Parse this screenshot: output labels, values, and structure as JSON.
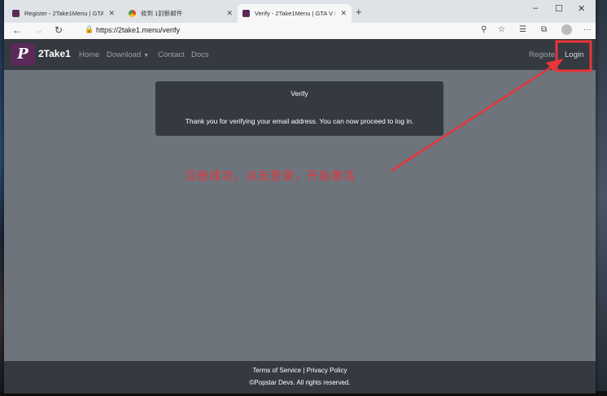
{
  "browser": {
    "tabs": [
      {
        "title": "Register - 2Take1Menu | GTA V M"
      },
      {
        "title": "收到 1封新邮件"
      },
      {
        "title": "Verify - 2Take1Menu | GTA V Mo"
      }
    ],
    "url": "https://2take1.menu/verify",
    "controls": {
      "minimize": "–",
      "maximize": "☐",
      "close": "✕"
    }
  },
  "site": {
    "logo_letter": "P",
    "brand": "2Take1",
    "nav": {
      "home": "Home",
      "download": "Download",
      "contact": "Contact",
      "docs": "Docs",
      "register": "Registe",
      "login": "Login"
    }
  },
  "verify_card": {
    "heading": "Verify",
    "message": "Thank you for verifying your email address. You can now proceed to log in."
  },
  "annotation": {
    "text": "注册成功，点击登录，开始激活",
    "color": "#e8353a"
  },
  "footer": {
    "terms": "Terms of Service",
    "separator": "|",
    "privacy": "Privacy Policy",
    "copyright": "©Popstar Devs. All rights reserved."
  },
  "colors": {
    "navbar": "#343a40",
    "page_bg": "#6d747c",
    "brand_purple": "#5b2a59"
  }
}
